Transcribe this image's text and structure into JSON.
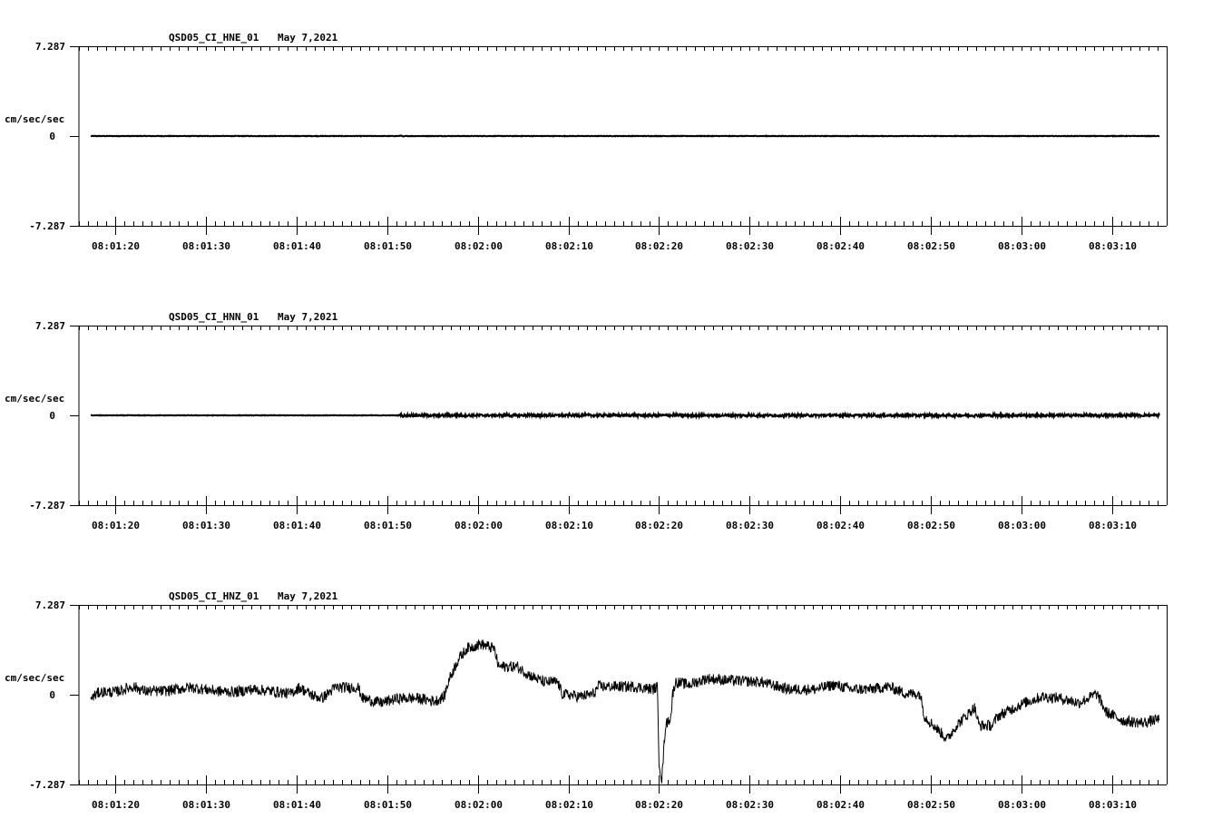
{
  "chart_data": [
    {
      "type": "line",
      "title": "QSD05_CI_HNE_01",
      "date": "May 7,2021",
      "ylabel": "cm/sec/sec",
      "ylim": [
        -7.287,
        7.287
      ],
      "ytick_labels": [
        "7.287",
        "0",
        "-7.287"
      ],
      "xlim_seconds_after_08_01_00": [
        16,
        136
      ],
      "xtick_labels": [
        "08:01:20",
        "08:01:30",
        "08:01:40",
        "08:01:50",
        "08:02:00",
        "08:02:10",
        "08:02:20",
        "08:02:30",
        "08:02:40",
        "08:02:50",
        "08:03:00",
        "08:03:10"
      ],
      "series": [
        {
          "name": "HNE",
          "points": [
            [
              17.3,
              0
            ],
            [
              51.3,
              0
            ],
            [
              51.5,
              0.05
            ],
            [
              51.8,
              -0.05
            ],
            [
              52.0,
              0
            ],
            [
              135.2,
              0
            ]
          ],
          "noise": 0.02
        }
      ]
    },
    {
      "type": "line",
      "title": "QSD05_CI_HNN_01",
      "date": "May 7,2021",
      "ylabel": "cm/sec/sec",
      "ylim": [
        -7.287,
        7.287
      ],
      "ytick_labels": [
        "7.287",
        "0",
        "-7.287"
      ],
      "xlim_seconds_after_08_01_00": [
        16,
        136
      ],
      "xtick_labels": [
        "08:01:20",
        "08:01:30",
        "08:01:40",
        "08:01:50",
        "08:02:00",
        "08:02:10",
        "08:02:20",
        "08:02:30",
        "08:02:40",
        "08:02:50",
        "08:03:00",
        "08:03:10"
      ],
      "series": [
        {
          "name": "HNN",
          "points": [
            [
              17.3,
              0
            ],
            [
              51.3,
              0
            ],
            [
              51.5,
              0.08
            ],
            [
              51.8,
              -0.08
            ],
            [
              52.0,
              0
            ],
            [
              135.2,
              0
            ]
          ],
          "noise": 0.02,
          "noise_after": 51.5,
          "noise_after_amp": 0.1
        }
      ]
    },
    {
      "type": "line",
      "title": "QSD05_CI_HNZ_01",
      "date": "May 7,2021",
      "ylabel": "cm/sec/sec",
      "ylim": [
        -7.287,
        7.287
      ],
      "ytick_labels": [
        "7.287",
        "0",
        "-7.287"
      ],
      "xlim_seconds_after_08_01_00": [
        16,
        136
      ],
      "xtick_labels": [
        "08:01:20",
        "08:01:30",
        "08:01:40",
        "08:01:50",
        "08:02:00",
        "08:02:10",
        "08:02:20",
        "08:02:30",
        "08:02:40",
        "08:02:50",
        "08:03:00",
        "08:03:10"
      ],
      "series": [
        {
          "name": "HNZ",
          "noise": 0.45,
          "points": [
            [
              17.3,
              -0.29
            ],
            [
              18.3,
              0.22
            ],
            [
              20.0,
              0.22
            ],
            [
              22.0,
              0.66
            ],
            [
              23.3,
              0.29
            ],
            [
              25.3,
              0.29
            ],
            [
              28.3,
              0.59
            ],
            [
              31.3,
              0.29
            ],
            [
              33.3,
              0.22
            ],
            [
              35.1,
              0.44
            ],
            [
              37.3,
              0.29
            ],
            [
              39.3,
              0.07
            ],
            [
              40.3,
              0.59
            ],
            [
              41.8,
              -0.07
            ],
            [
              42.8,
              -0.29
            ],
            [
              44.3,
              0.59
            ],
            [
              46.8,
              0.59
            ],
            [
              47.3,
              -0.29
            ],
            [
              49.3,
              -0.66
            ],
            [
              51.3,
              -0.29
            ],
            [
              53.3,
              -0.29
            ],
            [
              55.3,
              -0.52
            ],
            [
              56.3,
              -0.15
            ],
            [
              56.8,
              1.18
            ],
            [
              57.8,
              2.8
            ],
            [
              58.8,
              3.75
            ],
            [
              60.3,
              4.12
            ],
            [
              61.8,
              3.75
            ],
            [
              62.3,
              2.28
            ],
            [
              64.3,
              2.28
            ],
            [
              65.8,
              1.55
            ],
            [
              67.3,
              1.03
            ],
            [
              68.8,
              1.03
            ],
            [
              69.3,
              0.07
            ],
            [
              71.3,
              -0.15
            ],
            [
              72.8,
              0.07
            ],
            [
              73.3,
              0.66
            ],
            [
              77.3,
              0.66
            ],
            [
              79.3,
              0.44
            ],
            [
              79.8,
              0.66
            ],
            [
              80.0,
              -5.45
            ],
            [
              80.3,
              -6.92
            ],
            [
              80.7,
              -2.5
            ],
            [
              81.3,
              -1.77
            ],
            [
              81.5,
              0.07
            ],
            [
              81.8,
              1.03
            ],
            [
              83.3,
              0.81
            ],
            [
              85.3,
              1.32
            ],
            [
              87.3,
              1.18
            ],
            [
              91.3,
              1.03
            ],
            [
              92.3,
              0.81
            ],
            [
              94.3,
              0.44
            ],
            [
              97.3,
              0.44
            ],
            [
              99.3,
              0.81
            ],
            [
              101.3,
              0.44
            ],
            [
              103.3,
              0.44
            ],
            [
              105.3,
              0.66
            ],
            [
              107.3,
              0.07
            ],
            [
              108.8,
              0.07
            ],
            [
              109.3,
              -1.77
            ],
            [
              110.3,
              -2.5
            ],
            [
              111.8,
              -3.61
            ],
            [
              112.8,
              -2.5
            ],
            [
              113.8,
              -1.77
            ],
            [
              114.8,
              -1.03
            ],
            [
              115.3,
              -2.5
            ],
            [
              116.8,
              -2.5
            ],
            [
              117.3,
              -1.77
            ],
            [
              120.3,
              -0.66
            ],
            [
              122.3,
              -0.15
            ],
            [
              124.3,
              -0.29
            ],
            [
              126.3,
              -0.66
            ],
            [
              128.3,
              0.07
            ],
            [
              129.3,
              -1.4
            ],
            [
              131.3,
              -2.13
            ],
            [
              133.3,
              -2.28
            ],
            [
              135.2,
              -1.99
            ]
          ]
        }
      ]
    }
  ]
}
